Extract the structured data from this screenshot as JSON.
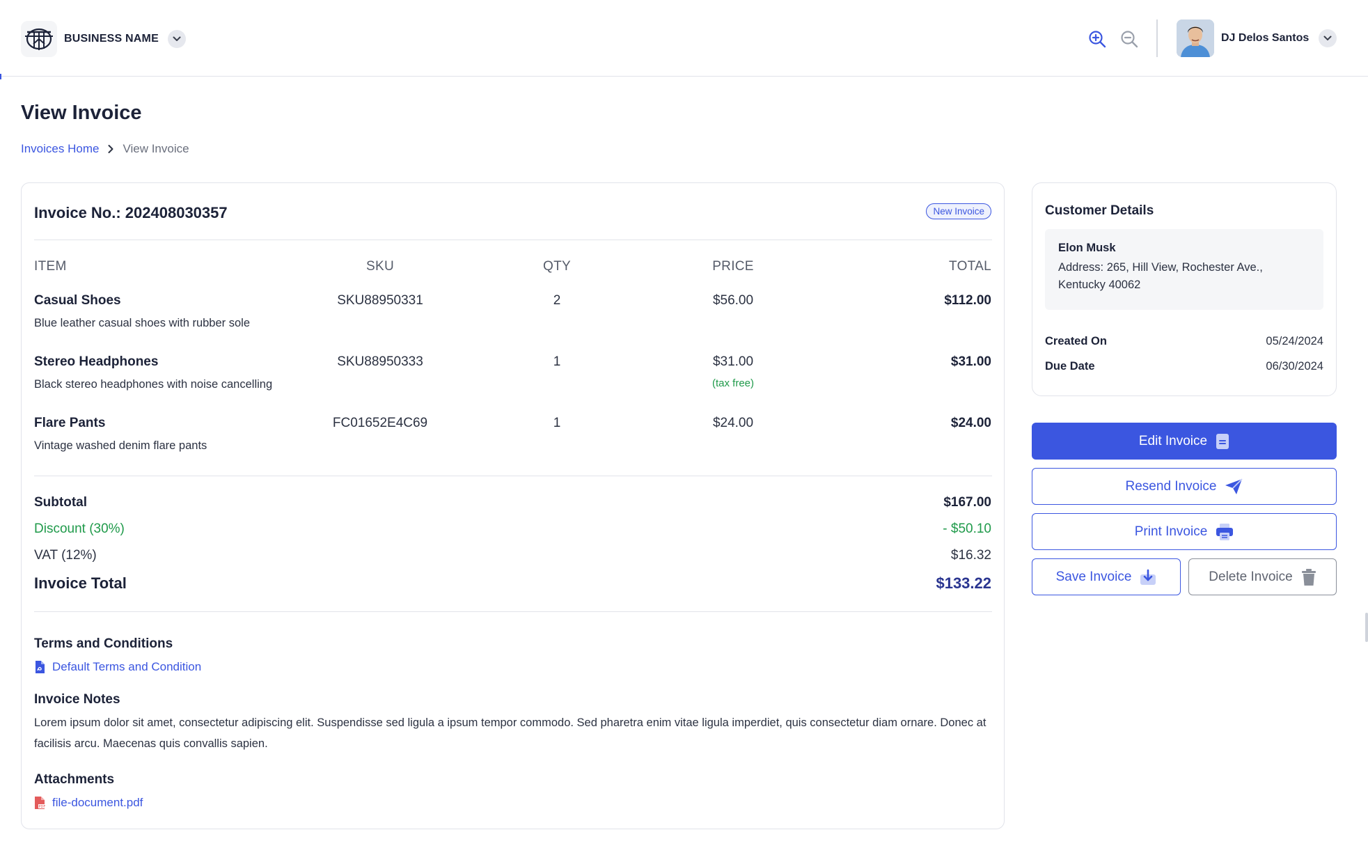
{
  "header": {
    "business_name": "BUSINESS NAME",
    "user_name": "DJ Delos Santos",
    "icons": [
      "logo-icon",
      "chevron-down-icon",
      "zoom-in-icon",
      "zoom-out-icon",
      "avatar"
    ]
  },
  "page": {
    "title": "View Invoice",
    "breadcrumb": {
      "home": "Invoices Home",
      "current": "View Invoice"
    }
  },
  "invoice": {
    "number_label": "Invoice No.: 202408030357",
    "badge": "New Invoice",
    "columns": {
      "item": "ITEM",
      "sku": "SKU",
      "qty": "QTY",
      "price": "PRICE",
      "total": "TOTAL"
    },
    "items": [
      {
        "name": "Casual Shoes",
        "desc": "Blue leather casual shoes with rubber sole",
        "sku": "SKU88950331",
        "qty": "2",
        "price": "$56.00",
        "note": "",
        "total": "$112.00"
      },
      {
        "name": "Stereo Headphones",
        "desc": "Black stereo headphones with noise cancelling",
        "sku": "SKU88950333",
        "qty": "1",
        "price": "$31.00",
        "note": "(tax free)",
        "total": "$31.00"
      },
      {
        "name": "Flare Pants",
        "desc": "Vintage washed denim flare pants",
        "sku": "FC01652E4C69",
        "qty": "1",
        "price": "$24.00",
        "note": "",
        "total": "$24.00"
      }
    ],
    "summary": {
      "subtotal_label": "Subtotal",
      "subtotal_value": "$167.00",
      "discount_label": "Discount (30%)",
      "discount_value": "- $50.10",
      "vat_label": "VAT (12%)",
      "vat_value": "$16.32",
      "total_label": "Invoice Total",
      "total_value": "$133.22"
    },
    "terms": {
      "title": "Terms and Conditions",
      "link": "Default Terms and Condition"
    },
    "notes": {
      "title": "Invoice Notes",
      "text": "Lorem ipsum dolor sit amet, consectetur adipiscing elit. Suspendisse sed ligula a ipsum tempor commodo. Sed pharetra enim vitae ligula imperdiet, quis consectetur diam ornare. Donec at facilisis arcu. Maecenas quis convallis sapien."
    },
    "attachments": {
      "title": "Attachments",
      "file": "file-document.pdf"
    }
  },
  "customer": {
    "title": "Customer Details",
    "name": "Elon Musk",
    "address": "Address: 265, Hill View, Rochester Ave., Kentucky 40062",
    "created_label": "Created On",
    "created_value": "05/24/2024",
    "due_label": "Due Date",
    "due_value": "06/30/2024"
  },
  "actions": {
    "edit": "Edit Invoice",
    "resend": "Resend Invoice",
    "print": "Print Invoice",
    "save": "Save Invoice",
    "delete": "Delete Invoice"
  },
  "colors": {
    "accent": "#3b56e0",
    "success": "#1f9a4a",
    "total": "#2a3590",
    "text": "#1c2238"
  }
}
